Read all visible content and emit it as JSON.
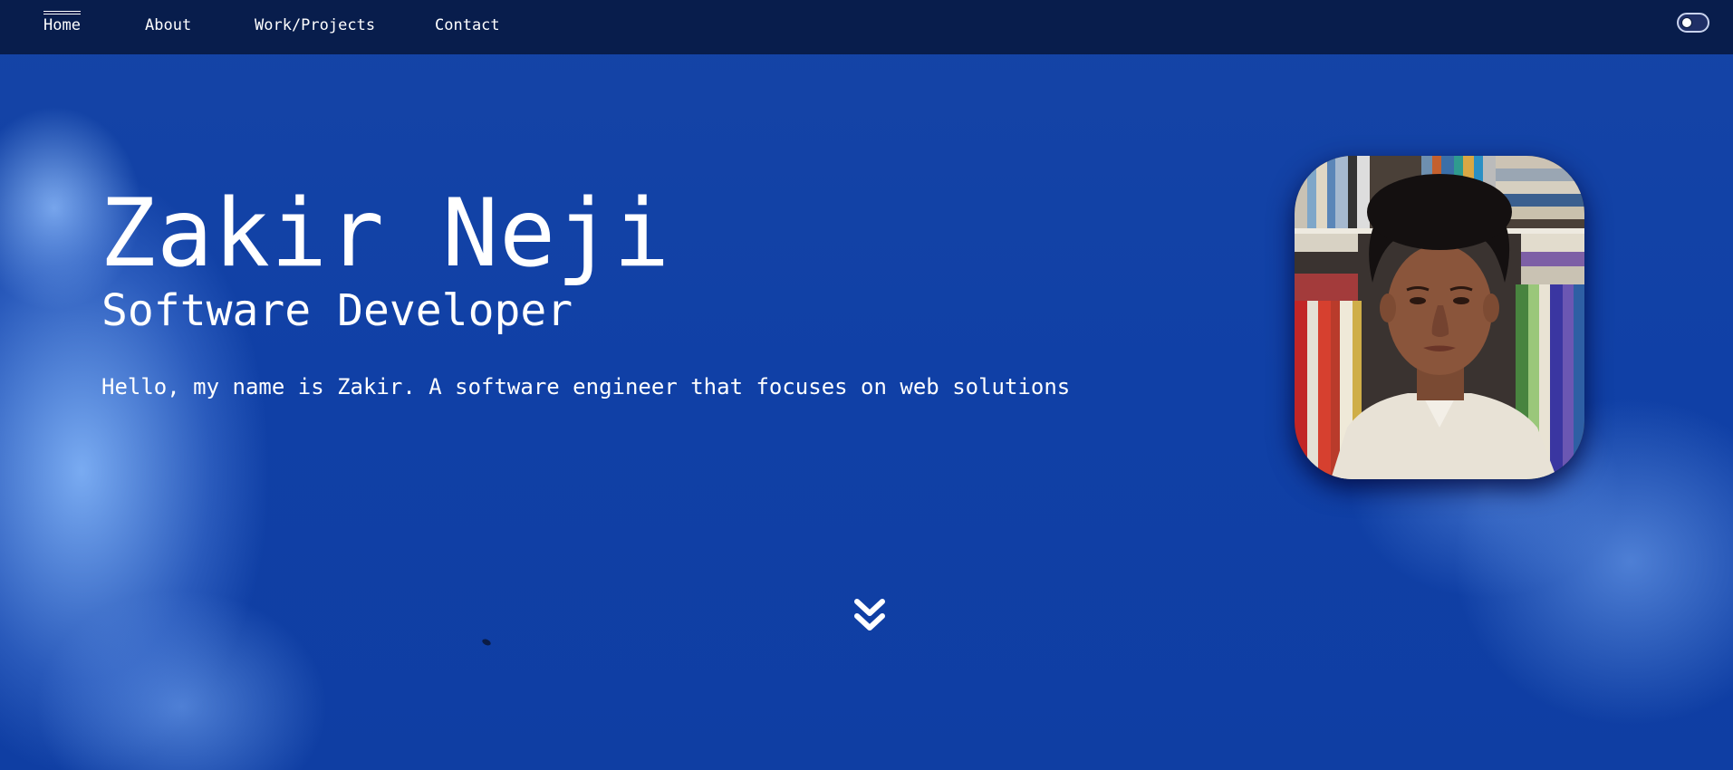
{
  "nav": {
    "items": [
      {
        "label": "Home",
        "active": true
      },
      {
        "label": "About",
        "active": false
      },
      {
        "label": "Work/Projects",
        "active": false
      },
      {
        "label": "Contact",
        "active": false
      }
    ],
    "theme_toggle": {
      "state": "off"
    }
  },
  "hero": {
    "name": "Zakir Neji",
    "title": "Software Developer",
    "intro": "Hello, my name is Zakir. A software engineer that focuses on web solutions"
  },
  "icons": {
    "scroll": "double-chevron-down-icon",
    "toggle": "theme-toggle-icon"
  },
  "colors": {
    "navbar_bg": "#081d4c",
    "sky_blue": "#0f3ea3",
    "text": "#ffffff"
  }
}
